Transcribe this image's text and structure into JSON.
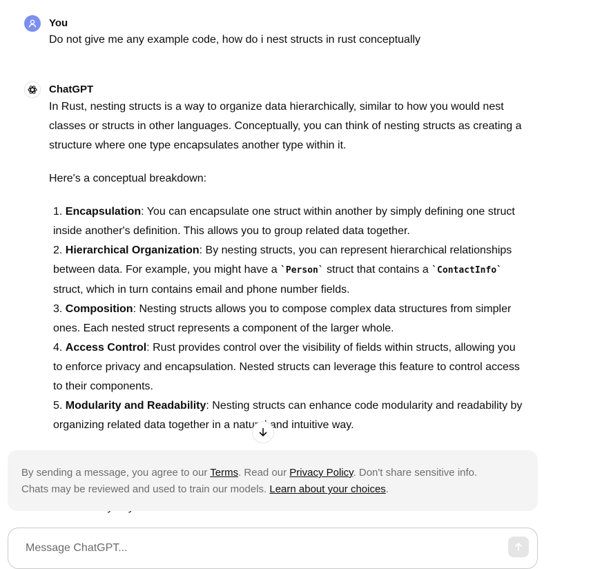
{
  "user_message": {
    "author": "You",
    "text": "Do not give me any example code, how do i nest structs in rust conceptually"
  },
  "assistant_message": {
    "author": "ChatGPT",
    "intro": "In Rust, nesting structs is a way to organize data hierarchically, similar to how you would nest classes or structs in other languages. Conceptually, you can think of nesting structs as creating a structure where one type encapsulates another type within it.",
    "breakdown_heading": "Here's a conceptual breakdown:",
    "items": [
      {
        "num": "1.",
        "title": "Encapsulation",
        "text": ": You can encapsulate one struct within another by simply defining one struct inside another's definition. This allows you to group related data together."
      },
      {
        "num": "2.",
        "title": "Hierarchical Organization",
        "text_a": ": By nesting structs, you can represent hierarchical relationships between data. For example, you might have a ",
        "code_a": "`Person`",
        "text_b": " struct that contains a ",
        "code_b": "`ContactInfo`",
        "text_c": " struct, which in turn contains email and phone number fields."
      },
      {
        "num": "3.",
        "title": "Composition",
        "text": ": Nesting structs allows you to compose complex data structures from simpler ones. Each nested struct represents a component of the larger whole."
      },
      {
        "num": "4.",
        "title": "Access Control",
        "text": ": Rust provides control over the visibility of fields within structs, allowing you to enforce privacy and encapsulation. Nested structs can leverage this feature to control access to their components."
      },
      {
        "num": "5.",
        "title": "Modularity and Readability",
        "text": ": Nesting structs can enhance code modularity and readability by organizing related data together in a natural and intuitive way."
      }
    ],
    "obscured_tail": "the hierarchy of your data structure."
  },
  "notice": {
    "prefix": "By sending a message, you agree to our ",
    "terms_link": "Terms",
    "mid": ". Read our ",
    "privacy_link": "Privacy Policy",
    "suffix_line1": ". Don't share sensitive info.",
    "line2": "Chats may be reviewed and used to train our models. ",
    "choices_link": "Learn about your choices",
    "end": "."
  },
  "composer": {
    "placeholder": "Message ChatGPT..."
  },
  "icons": {
    "user_avatar": "person-icon",
    "assistant_avatar": "openai-logo-icon",
    "scroll": "arrow-down-icon",
    "send": "arrow-up-icon"
  },
  "colors": {
    "user_avatar_bg": "#7c8ff0",
    "notice_bg": "#f4f4f4",
    "text": "#0d0d0d",
    "muted_text": "#6e6e6e"
  }
}
